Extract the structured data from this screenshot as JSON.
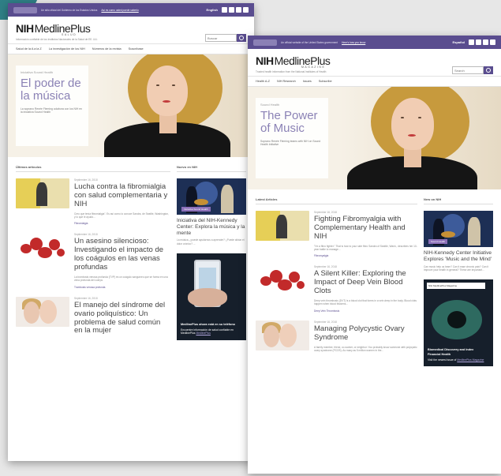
{
  "spanish": {
    "topbar": {
      "hhs_text": "Departamento de Salud y Servicios Humanos",
      "gov_text": "Un sitio oficial del Gobierno de los Estados Unidos",
      "gov_link": "Así es como usted puede saberlo",
      "language": "English"
    },
    "brand": {
      "logo_nih": "NIH",
      "logo_medlineplus": "MedlinePlus",
      "logo_sub": "SALUD",
      "tagline": "Información confiable de los Institutos Nacionales de la Salud de EE. UU."
    },
    "search": {
      "placeholder": "Buscar"
    },
    "nav": [
      "Salud de la A a la Z",
      "La investigación de los NIH",
      "Números de la revista",
      "Suscríbase"
    ],
    "hero": {
      "eyebrow": "Iniciativa Sound Health",
      "title": "El poder de la música",
      "desc": "La soprano Renée Fleming colabora con los NIH en la iniciativa Sound Health"
    },
    "latest_heading": "Últimos artículos",
    "articles": [
      {
        "date": "Septiembre 16, 2018",
        "title": "Lucha contra la fibromialgia con salud complementaria y NIH",
        "desc": "Creo que tenía fibromialgia\". Es así como lo conoce Sandra, de Seattle, Washington, y lo que le ayudó...",
        "tag": "Fibromialgia"
      },
      {
        "date": "Septiembre 16, 2018",
        "title": "Un asesino silencioso: Investigando el impacto de los coágulos en las venas profundas",
        "desc": "La trombosis venosa profunda (TVP) es un coágulo sanguíneo que se forma en una vena profunda del cuerpo.",
        "tag": "Trombosis venosa profunda"
      },
      {
        "date": "Septiembre 16, 2018",
        "title": "El manejo del síndrome del ovario poliquístico: Un problema de salud común en la mujer",
        "desc": "",
        "tag": ""
      }
    ],
    "side_heading": "Nuevo en NIH",
    "side_card": {
      "badge": "Iniciativa Sound Health",
      "title": "Iniciativa del NIH-Kennedy Center: Explora la música y la mente",
      "desc": "La música, ¿puede ayudarnos a aprender? ¿Puede aliviar el dolor crónico? ..."
    },
    "promo": {
      "title": "MedlinePlus ahora está en su teléfono",
      "desc": "Encuentre información de salud confiable en MedlinePlus",
      "link": "MedlinePlus"
    }
  },
  "english": {
    "topbar": {
      "hhs_text": "U.S. National Library of Medicine",
      "gov_text": "An official website of the United States government",
      "gov_link": "Here's how you know",
      "language": "Español"
    },
    "brand": {
      "logo_nih": "NIH",
      "logo_medlineplus": "MedlinePlus",
      "logo_sub": "MAGAZINE",
      "tagline": "Trusted health information from the National Institutes of Health"
    },
    "search": {
      "placeholder": "Search"
    },
    "nav": [
      "Health A-Z",
      "NIH Research",
      "Issues",
      "Subscribe"
    ],
    "hero": {
      "eyebrow": "Sound Health",
      "title": "The Power of Music",
      "desc": "Soprano Renée Fleming teams with NIH on Sound Health Initiative"
    },
    "latest_heading": "Latest Articles",
    "articles": [
      {
        "date": "September 16, 2018",
        "title": "Fighting Fibromyalgia with Complementary Health and NIH",
        "desc": "\"I'm a fibro fighter.\" That is how to your side fibro Sandra of Seattle, Wash., describes her 10-year battle to manage...",
        "tag": "Fibromyalgia"
      },
      {
        "date": "September 16, 2018",
        "title": "A Silent Killer: Exploring the Impact of Deep Vein Blood Clots",
        "desc": "Deep vein thrombosis (DVT) is a blood clot that forms in a vein deep in the body. Blood clots happen when blood thickens...",
        "tag": "Deep Vein Thrombosis"
      },
      {
        "date": "September 16, 2018",
        "title": "Managing Polycystic Ovary Syndrome",
        "desc": "A family member, friend, co-worker, or neighbor: You probably know someone with polycystic ovary syndrome (PCOS). As many as 5 million women in the...",
        "tag": ""
      }
    ],
    "side_heading": "New on NIH",
    "side_card": {
      "badge": "Sound Health",
      "title": "NIH-Kennedy Center Initiative Explores 'Music and the Mind'",
      "desc": "Can music help us learn? Can it ease chronic pain? Can it improve your health in general? These are important..."
    },
    "promo": {
      "bar": "NIH MedlinePlus Magazine",
      "title": "Biomedical Discovery and Index Financial Health",
      "desc": "Visit the newest issue of",
      "link": "MedlinePlus Magazine"
    }
  },
  "colors": {
    "topbar": "#5a4d8f",
    "hero_title": "#8b82b5",
    "accent": "#5a4d8f"
  },
  "icons": [
    "search-icon",
    "facebook-icon",
    "twitter-icon",
    "email-icon",
    "rss-icon"
  ]
}
